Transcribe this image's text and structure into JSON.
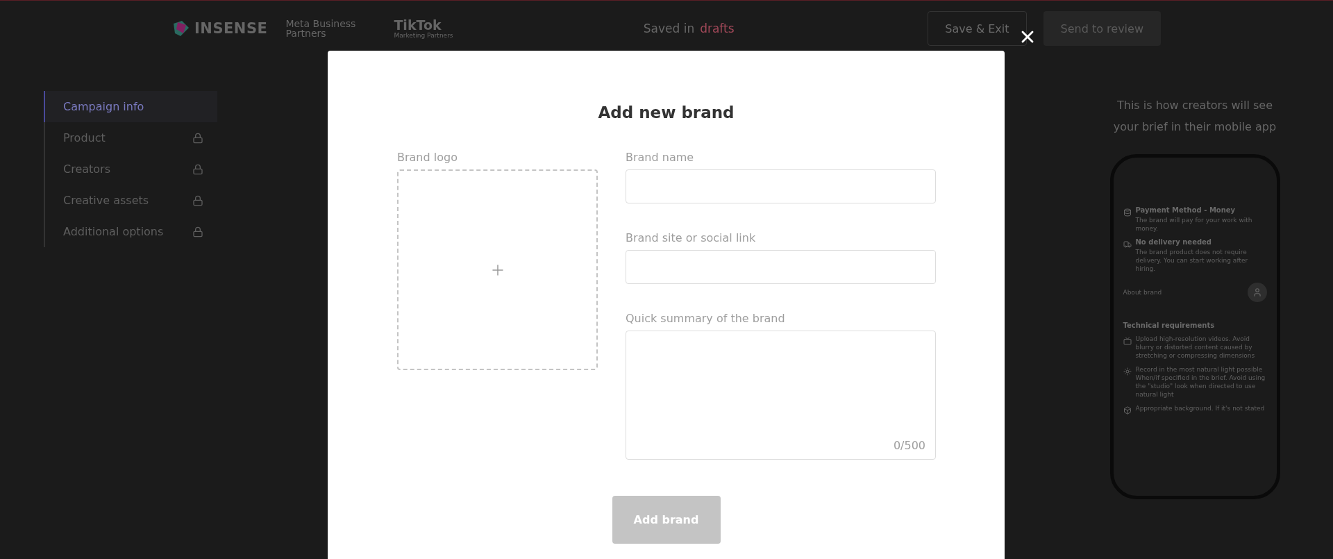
{
  "header": {
    "logos": [
      {
        "kind": "insense",
        "text": "INSENSE"
      },
      {
        "kind": "meta",
        "text": "Meta Business Partners"
      },
      {
        "kind": "tiktok",
        "text": "TikTok",
        "subtext": "Marketing Partners"
      }
    ],
    "status": {
      "label": "Saved in",
      "link": "drafts"
    },
    "buttons": [
      {
        "label": "Save & Exit",
        "kind": "outline",
        "disabled": false
      },
      {
        "label": "Send to review",
        "kind": "primary",
        "disabled": true
      }
    ]
  },
  "sidebar": {
    "items": [
      {
        "label": "Campaign info",
        "selected": true,
        "locked": false
      },
      {
        "label": "Product",
        "selected": false,
        "locked": true
      },
      {
        "label": "Creators",
        "selected": false,
        "locked": true
      },
      {
        "label": "Creative assets",
        "selected": false,
        "locked": true
      },
      {
        "label": "Additional options",
        "selected": false,
        "locked": true
      }
    ]
  },
  "preview": {
    "caption": "This is how creators will see your brief in their mobile app",
    "features": [
      {
        "kind": "money",
        "title": "Payment Method - Money",
        "text": "The brand will pay for your work with money."
      },
      {
        "kind": "no-delivery",
        "title": "No delivery needed",
        "text": "The brand product does not require delivery. You can start working after hiring."
      }
    ],
    "about_label": "About brand",
    "requirements_title": "Technical requirements",
    "requirements": [
      {
        "kind": "hd",
        "text": "Upload high-resolution videos. Avoid blurry or distorted content caused by stretching or compressing dimensions"
      },
      {
        "kind": "light",
        "text": "Record in the most natural light possible When/if specified in the brief. Avoid using the \"studio\" look when directed to use natural light"
      },
      {
        "kind": "box",
        "text": "Appropriate background. If it's not stated"
      }
    ]
  },
  "modal": {
    "title": "Add new brand",
    "logo_label": "Brand logo",
    "fields": [
      {
        "kind": "input",
        "label": "Brand name"
      },
      {
        "kind": "input",
        "label": "Brand site or social link"
      },
      {
        "kind": "textarea",
        "label": "Quick summary of the brand",
        "counter": "0/500"
      }
    ],
    "submit": {
      "label": "Add brand",
      "disabled": true
    }
  }
}
